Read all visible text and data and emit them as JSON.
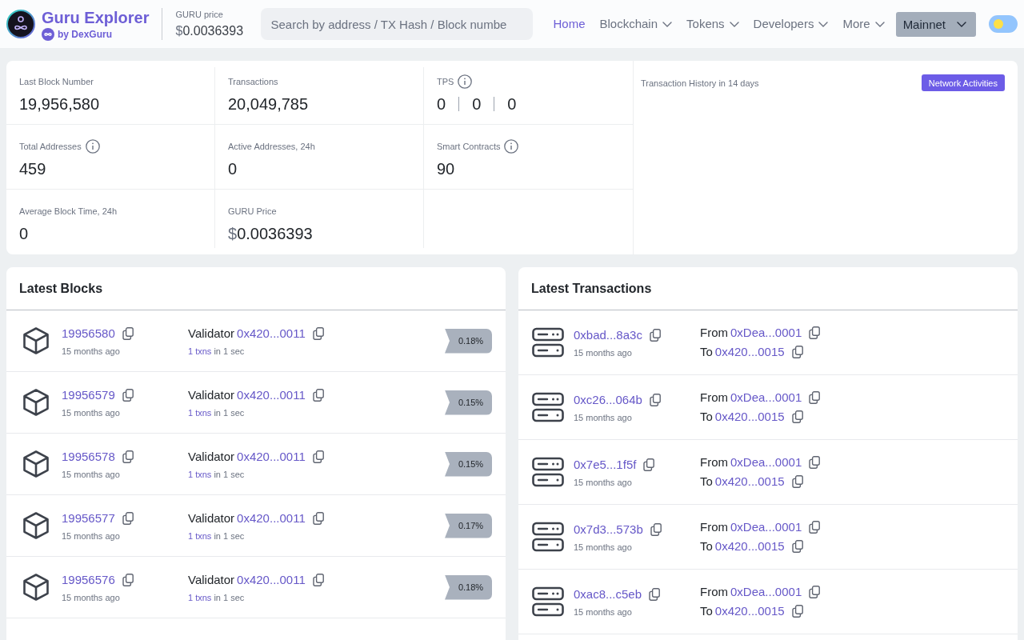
{
  "header": {
    "logo": {
      "title": "Guru Explorer",
      "subtitle": "by DexGuru"
    },
    "price": {
      "label": "GURU price",
      "currency": "$",
      "value": "0.0036393"
    },
    "search": {
      "placeholder": "Search by address / TX Hash / Block numbe"
    },
    "nav": [
      {
        "label": "Home",
        "selected": true,
        "dropdown": false
      },
      {
        "label": "Blockchain",
        "selected": false,
        "dropdown": true
      },
      {
        "label": "Tokens",
        "selected": false,
        "dropdown": true
      },
      {
        "label": "Developers",
        "selected": false,
        "dropdown": true
      },
      {
        "label": "More",
        "selected": false,
        "dropdown": true
      }
    ],
    "network_select": {
      "label": "Mainnet"
    },
    "theme_toggle": {
      "on": false
    }
  },
  "stats": {
    "items": [
      {
        "label": "Last Block Number",
        "info": false,
        "values": [
          "19,956,580"
        ]
      },
      {
        "label": "Transactions",
        "info": false,
        "values": [
          "20,049,785"
        ]
      },
      {
        "label": "TPS",
        "info": true,
        "values": [
          "0",
          "0",
          "0"
        ]
      },
      {
        "label": "Total Addresses",
        "info": true,
        "values": [
          "459"
        ]
      },
      {
        "label": "Active Addresses, 24h",
        "info": false,
        "values": [
          "0"
        ]
      },
      {
        "label": "Smart Contracts",
        "info": true,
        "values": [
          "90"
        ]
      },
      {
        "label": "Average Block Time, 24h",
        "info": false,
        "values": [
          "0"
        ]
      },
      {
        "label": "GURU Price",
        "info": false,
        "currency": "$",
        "values": [
          "0.0036393"
        ]
      }
    ],
    "history": {
      "title": "Transaction History in 14 days",
      "button": "Network Activities"
    }
  },
  "latest_blocks": {
    "title": "Latest Blocks",
    "rows": [
      {
        "number": "19956580",
        "age": "15 months ago",
        "validator_label": "Validator",
        "validator": "0x420...0011",
        "txns": "1 txns",
        "duration": "in 1 sec",
        "gas": "0.18%"
      },
      {
        "number": "19956579",
        "age": "15 months ago",
        "validator_label": "Validator",
        "validator": "0x420...0011",
        "txns": "1 txns",
        "duration": "in 1 sec",
        "gas": "0.15%"
      },
      {
        "number": "19956578",
        "age": "15 months ago",
        "validator_label": "Validator",
        "validator": "0x420...0011",
        "txns": "1 txns",
        "duration": "in 1 sec",
        "gas": "0.15%"
      },
      {
        "number": "19956577",
        "age": "15 months ago",
        "validator_label": "Validator",
        "validator": "0x420...0011",
        "txns": "1 txns",
        "duration": "in 1 sec",
        "gas": "0.17%"
      },
      {
        "number": "19956576",
        "age": "15 months ago",
        "validator_label": "Validator",
        "validator": "0x420...0011",
        "txns": "1 txns",
        "duration": "in 1 sec",
        "gas": "0.18%"
      }
    ]
  },
  "latest_transactions": {
    "title": "Latest Transactions",
    "rows": [
      {
        "hash": "0xbad...8a3c",
        "age": "15 months ago",
        "from_label": "From",
        "from": "0xDea...0001",
        "to_label": "To",
        "to": "0x420...0015"
      },
      {
        "hash": "0xc26...064b",
        "age": "15 months ago",
        "from_label": "From",
        "from": "0xDea...0001",
        "to_label": "To",
        "to": "0x420...0015"
      },
      {
        "hash": "0x7e5...1f5f",
        "age": "15 months ago",
        "from_label": "From",
        "from": "0xDea...0001",
        "to_label": "To",
        "to": "0x420...0015"
      },
      {
        "hash": "0x7d3...573b",
        "age": "15 months ago",
        "from_label": "From",
        "from": "0xDea...0001",
        "to_label": "To",
        "to": "0x420...0015"
      },
      {
        "hash": "0xac8...c5eb",
        "age": "15 months ago",
        "from_label": "From",
        "from": "0xDea...0001",
        "to_label": "To",
        "to": "0x420...0015"
      }
    ]
  }
}
